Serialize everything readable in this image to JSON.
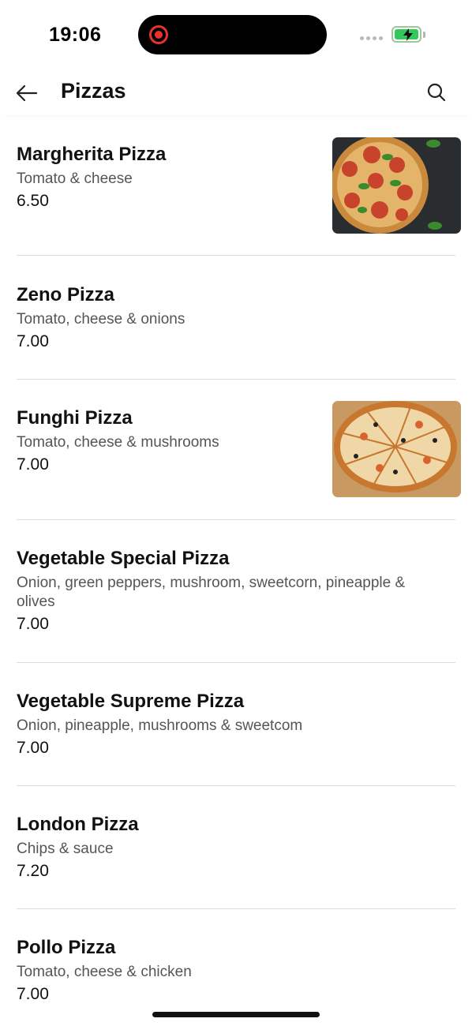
{
  "status_bar": {
    "time": "19:06"
  },
  "header": {
    "title": "Pizzas",
    "back_icon": "arrow-left-icon",
    "search_icon": "search-icon"
  },
  "items": [
    {
      "name": "Margherita Pizza",
      "description": "Tomato & cheese",
      "price": "6.50",
      "has_image": true
    },
    {
      "name": "Zeno Pizza",
      "description": "Tomato, cheese & onions",
      "price": "7.00",
      "has_image": false
    },
    {
      "name": "Funghi Pizza",
      "description": "Tomato, cheese & mushrooms",
      "price": "7.00",
      "has_image": true
    },
    {
      "name": "Vegetable Special Pizza",
      "description": "Onion, green peppers, mushroom, sweetcorn, pineapple & olives",
      "price": "7.00",
      "has_image": false
    },
    {
      "name": "Vegetable Supreme Pizza",
      "description": "Onion, pineapple, mushrooms & sweetcom",
      "price": "7.00",
      "has_image": false
    },
    {
      "name": "London Pizza",
      "description": "Chips & sauce",
      "price": "7.20",
      "has_image": false
    },
    {
      "name": "Pollo Pizza",
      "description": "Tomato, cheese & chicken",
      "price": "7.00",
      "has_image": false
    }
  ],
  "colors": {
    "battery_green": "#34c759",
    "record_red": "#e8322c",
    "divider": "#dcdcdc"
  }
}
